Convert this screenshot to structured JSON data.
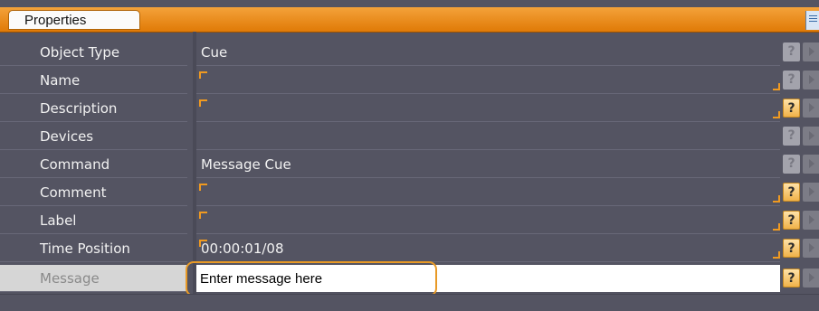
{
  "panel": {
    "tab_label": "Properties",
    "accent_color": "#f0900f",
    "header_icon": "grid-view-icon"
  },
  "rows": [
    {
      "label": "Object Type",
      "value": "Cue",
      "help_active": false
    },
    {
      "label": "Name",
      "value": "",
      "help_active": false
    },
    {
      "label": "Description",
      "value": "",
      "help_active": true
    },
    {
      "label": "Devices",
      "value": "",
      "help_active": false
    },
    {
      "label": "Command",
      "value": "Message Cue",
      "help_active": false
    },
    {
      "label": "Comment",
      "value": "",
      "help_active": true
    },
    {
      "label": "Label",
      "value": "",
      "help_active": true
    },
    {
      "label": "Time Position",
      "value": "00:00:01/08",
      "help_active": true
    }
  ],
  "message_row": {
    "label": "Message",
    "value": "Enter message here"
  },
  "icons": {
    "help": "help-question-icon",
    "expand": "expand-arrow-icon"
  }
}
